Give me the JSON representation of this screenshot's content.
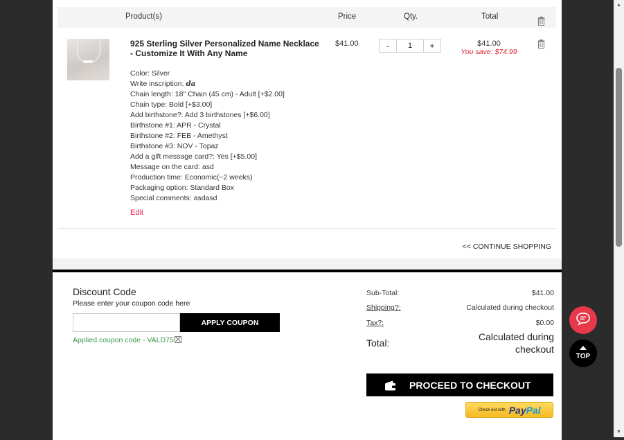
{
  "table_header": {
    "product": "Product(s)",
    "price": "Price",
    "qty": "Qty.",
    "total": "Total"
  },
  "item": {
    "name": "925 Sterling Silver Personalized Name Necklace - Customize It With Any Name",
    "options": [
      "Color: Silver",
      "Write inscription: ",
      "Chain length: 18\" Chain (45 cm) - Adult [+$2.00]",
      "Chain type: Bold [+$3.00]",
      "Add birthstone?: Add 3 birthstones [+$6.00]",
      "Birthstone #1: APR - Crystal",
      "Birthstone #2: FEB - Amethyst",
      "Birthstone #3: NOV - Topaz",
      "Add a gift message card?: Yes [+$5.00]",
      "Message on the card: asd",
      "Production time: Economic(~2 weeks)",
      "Packaging option: Standard Box",
      "Special comments: asdasd"
    ],
    "inscription_value": "da",
    "edit_label": "Edit",
    "price": "$41.00",
    "quantity": "1",
    "qty_minus": "-",
    "qty_plus": "+",
    "total": "$41.00",
    "you_save": "You save: $74.99"
  },
  "continue_shopping": "<< CONTINUE SHOPPING",
  "discount": {
    "title": "Discount Code",
    "subtitle": "Please enter your coupon code here",
    "input_value": "",
    "apply_label": "APPLY COUPON",
    "applied_text": "Applied coupon code - VALD75"
  },
  "summary": {
    "subtotal_label": "Sub-Total:",
    "subtotal_value": "$41.00",
    "shipping_label": "Shipping?:",
    "shipping_value": "Calculated during checkout",
    "tax_label": "Tax?:",
    "tax_value": "$0.00",
    "total_label": "Total:",
    "total_value_line1": "Calculated during",
    "total_value_line2": "checkout"
  },
  "checkout_label": "PROCEED TO CHECKOUT",
  "paypal": {
    "small": "Check out with",
    "pay": "Pay",
    "pal": "Pal"
  },
  "top_label": "TOP",
  "colors": {
    "accent": "#e02050",
    "save": "#e02030",
    "applied": "#3a9a4a",
    "chat": "#e8394a"
  },
  "icons": [
    "trash-icon",
    "wallet-icon",
    "chat-icon",
    "arrow-up-icon",
    "paypal-logo"
  ]
}
